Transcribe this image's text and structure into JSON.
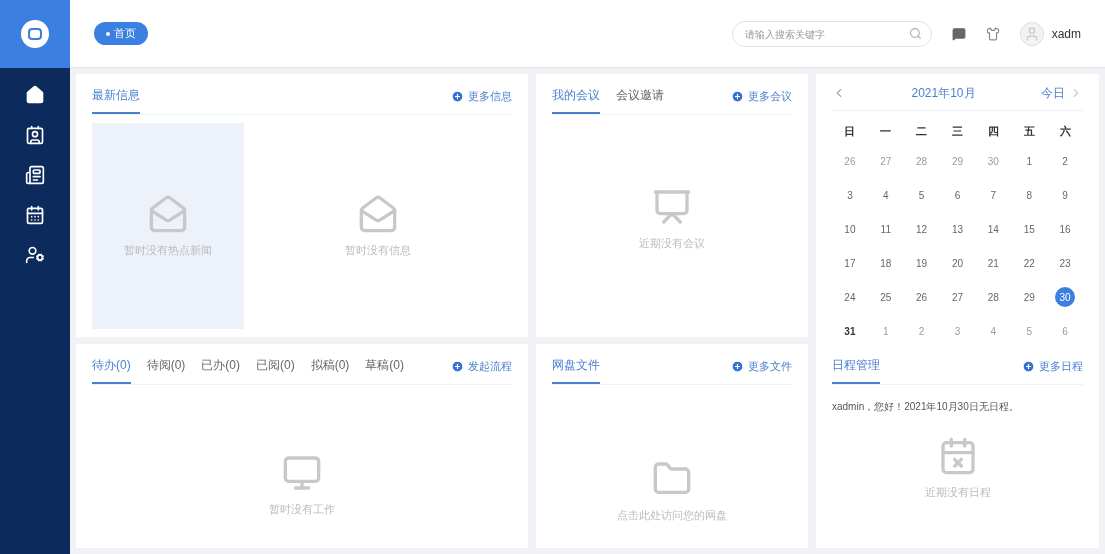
{
  "header": {
    "tag": "首页",
    "search": {
      "placeholder": "请输入搜索关键字"
    },
    "username": "xadm"
  },
  "news": {
    "tabs": [
      {
        "label": "最新信息",
        "selected": true
      }
    ],
    "more": "更多信息",
    "empties": [
      {
        "text": "暂时没有热点新闻",
        "highlighted": true
      },
      {
        "text": "暂时没有信息",
        "highlighted": false
      }
    ]
  },
  "meetings": {
    "tabs": [
      {
        "label": "我的会议",
        "selected": true
      },
      {
        "label": "会议邀请",
        "selected": false
      }
    ],
    "more": "更多会议",
    "empty": "近期没有会议"
  },
  "calendar": {
    "title": "2021年10月",
    "today": "今日",
    "weekdays": [
      "日",
      "一",
      "二",
      "三",
      "四",
      "五",
      "六"
    ],
    "days": [
      {
        "label": "26",
        "kind": "other",
        "selected": false
      },
      {
        "label": "27",
        "kind": "other",
        "selected": false
      },
      {
        "label": "28",
        "kind": "other",
        "selected": false
      },
      {
        "label": "29",
        "kind": "other",
        "selected": false
      },
      {
        "label": "30",
        "kind": "other",
        "selected": false
      },
      {
        "label": "1",
        "kind": "current",
        "selected": false
      },
      {
        "label": "2",
        "kind": "current",
        "selected": false
      },
      {
        "label": "3",
        "kind": "current",
        "selected": false
      },
      {
        "label": "4",
        "kind": "current",
        "selected": false
      },
      {
        "label": "5",
        "kind": "current",
        "selected": false
      },
      {
        "label": "6",
        "kind": "current",
        "selected": false
      },
      {
        "label": "7",
        "kind": "current",
        "selected": false
      },
      {
        "label": "8",
        "kind": "current",
        "selected": false
      },
      {
        "label": "9",
        "kind": "current",
        "selected": false
      },
      {
        "label": "10",
        "kind": "current",
        "selected": false
      },
      {
        "label": "11",
        "kind": "current",
        "selected": false
      },
      {
        "label": "12",
        "kind": "current",
        "selected": false
      },
      {
        "label": "13",
        "kind": "current",
        "selected": false
      },
      {
        "label": "14",
        "kind": "current",
        "selected": false
      },
      {
        "label": "15",
        "kind": "current",
        "selected": false
      },
      {
        "label": "16",
        "kind": "current",
        "selected": false
      },
      {
        "label": "17",
        "kind": "current",
        "selected": false
      },
      {
        "label": "18",
        "kind": "current",
        "selected": false
      },
      {
        "label": "19",
        "kind": "current",
        "selected": false
      },
      {
        "label": "20",
        "kind": "current",
        "selected": false
      },
      {
        "label": "21",
        "kind": "current",
        "selected": false
      },
      {
        "label": "22",
        "kind": "current",
        "selected": false
      },
      {
        "label": "23",
        "kind": "current",
        "selected": false
      },
      {
        "label": "24",
        "kind": "current",
        "selected": false
      },
      {
        "label": "25",
        "kind": "current",
        "selected": false
      },
      {
        "label": "26",
        "kind": "current",
        "selected": false
      },
      {
        "label": "27",
        "kind": "current",
        "selected": false
      },
      {
        "label": "28",
        "kind": "current",
        "selected": false
      },
      {
        "label": "29",
        "kind": "current",
        "selected": false
      },
      {
        "label": "30",
        "kind": "current",
        "selected": true
      },
      {
        "label": "31",
        "kind": "bold",
        "selected": false
      },
      {
        "label": "1",
        "kind": "other",
        "selected": false
      },
      {
        "label": "2",
        "kind": "other",
        "selected": false
      },
      {
        "label": "3",
        "kind": "other",
        "selected": false
      },
      {
        "label": "4",
        "kind": "other",
        "selected": false
      },
      {
        "label": "5",
        "kind": "other",
        "selected": false
      },
      {
        "label": "6",
        "kind": "other",
        "selected": false
      }
    ]
  },
  "todo": {
    "tabs": [
      {
        "label": "待办(0)",
        "selected": true
      },
      {
        "label": "待阅(0)",
        "selected": false
      },
      {
        "label": "已办(0)",
        "selected": false
      },
      {
        "label": "已阅(0)",
        "selected": false
      },
      {
        "label": "拟稿(0)",
        "selected": false
      },
      {
        "label": "草稿(0)",
        "selected": false
      }
    ],
    "more": "发起流程",
    "empty": "暂时没有工作"
  },
  "files": {
    "tabs": [
      {
        "label": "网盘文件",
        "selected": true
      }
    ],
    "more": "更多文件",
    "empty": "点击此处访问您的网盘"
  },
  "schedule": {
    "tabs": [
      {
        "label": "日程管理",
        "selected": true
      }
    ],
    "more": "更多日程",
    "message": "xadmin，您好！2021年10月30日无日程。",
    "empty": "近期没有日程"
  }
}
